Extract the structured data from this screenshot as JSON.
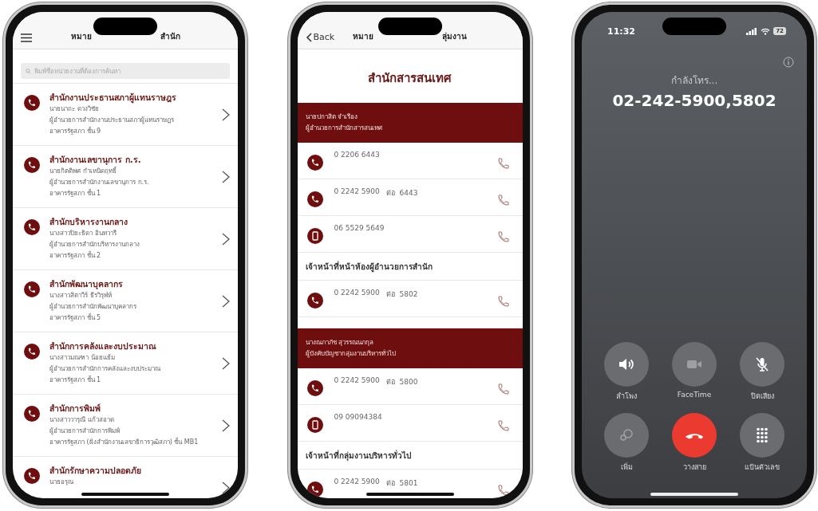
{
  "directory": {
    "title_left": "หมาย",
    "title_right": "สำนัก",
    "search": {
      "placeholder": "พิมพ์ชื่อหน่วยงานที่ต้องการค้นหา"
    },
    "items": [
      {
        "title": "สำนักงานประธานสภาผู้แทนราษฎร",
        "lines": [
          "นายนาถะ ดวงวิชัย",
          "ผู้อำนวยการสำนักงานประธานสภาผู้แทนราษฎร",
          "อาคารรัฐสภา ชั้น 9"
        ]
      },
      {
        "title": "สำนักงานเลขานุการ ก.ร.",
        "lines": [
          "นายกิตติพศ กำเหนิดฤทธิ์",
          "ผู้อำนวยการสำนักงานเลขานุการ ก.ร.",
          "อาคารรัฐสภา ชั้น 1"
        ]
      },
      {
        "title": "สำนักบริหารงานกลาง",
        "lines": [
          "นางสาวปิยะธิดา อินทวารี",
          "ผู้อำนวยการสำนักบริหารงานกลาง",
          "อาคารรัฐสภา ชั้น 2"
        ]
      },
      {
        "title": "สำนักพัฒนาบุคลากร",
        "lines": [
          "นางสาวสิตาวีร์ ธีรวิรุฬห์",
          "ผู้อำนวยการสำนักพัฒนาบุคลากร",
          "อาคารรัฐสภา ชั้น 5"
        ]
      },
      {
        "title": "สำนักการคลังและงบประมาณ",
        "lines": [
          "นางสาวมณฑา น้อยแย้ม",
          "ผู้อำนวยการสำนักการคลังและงบประมาณ",
          "อาคารรัฐสภา ชั้น 1"
        ]
      },
      {
        "title": "สำนักการพิมพ์",
        "lines": [
          "นางสาววารุณี แก้วสอาด",
          "ผู้อำนวยการสำนักการพิมพ์",
          "อาคารรัฐสภา (ฝั่งสำนักงานเลขาธิการวุฒิสภา) ชั้น MB1"
        ]
      },
      {
        "title": "สำนักรักษาความปลอดภัย",
        "lines": [
          "นายอรุณ"
        ]
      }
    ]
  },
  "contact": {
    "back": "Back",
    "title_left": "หมาย",
    "title_right": "ลุ่มงาน",
    "heading": "สำนักสารสนเทศ",
    "entries": [
      {
        "kind": "person",
        "name": "นายปกาสิต จำเรือง",
        "position": "ผู้อำนวยการสำนักสารสนเทศ"
      },
      {
        "kind": "landline",
        "number": "0 2206 6443"
      },
      {
        "kind": "landline",
        "number": "0 2242 5900",
        "extension": "ต่อ  6443"
      },
      {
        "kind": "mobile",
        "number": "06 5529 5649"
      },
      {
        "kind": "section",
        "label": "เจ้าหน้าที่หน้าห้องผู้อำนวยการสำนัก"
      },
      {
        "kind": "landline",
        "number": "0 2242 5900",
        "extension": "ต่อ  5802"
      },
      {
        "kind": "person",
        "name": "นางณภาภัช สุวรรณนภกุล",
        "position": "ผู้บังคับบัญชากลุ่มงานบริหารทั่วไป"
      },
      {
        "kind": "landline",
        "number": "0 2242 5900",
        "extension": "ต่อ  5800"
      },
      {
        "kind": "mobile",
        "number": "09 09094384"
      },
      {
        "kind": "section",
        "label": "เจ้าหน้าที่กลุ่มงานบริหารทั่วไป"
      },
      {
        "kind": "landline",
        "number": "0 2242 5900",
        "extension": "ต่อ  5801"
      }
    ]
  },
  "call": {
    "time": "11:32",
    "battery": "72",
    "status": "กำลังโทร...",
    "number": "02-242-5900,5802",
    "buttons": [
      {
        "kind": "speaker",
        "label": "ลำโพง",
        "disabled": false
      },
      {
        "kind": "facetime",
        "label": "FaceTime",
        "disabled": true
      },
      {
        "kind": "mute",
        "label": "ปิดเสียง",
        "disabled": false
      },
      {
        "kind": "add",
        "label": "เพิ่ม",
        "disabled": true
      },
      {
        "kind": "end",
        "label": "วางสาย",
        "disabled": false
      },
      {
        "kind": "keypad",
        "label": "แป้นตัวเลข",
        "disabled": false
      }
    ]
  }
}
